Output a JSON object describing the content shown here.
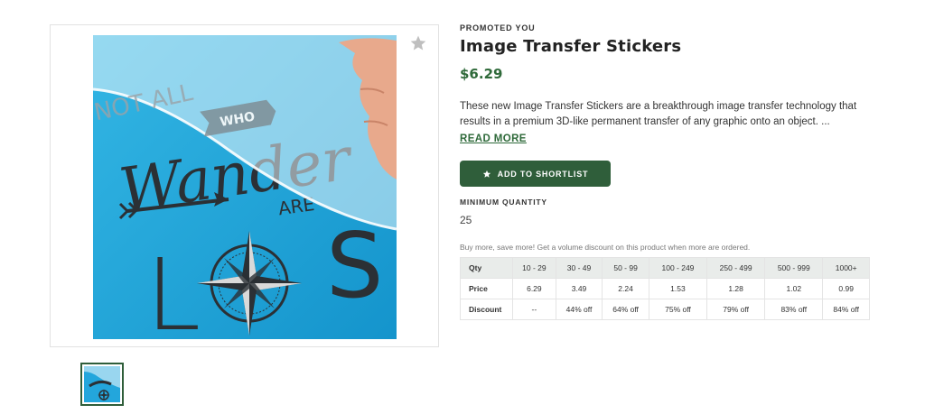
{
  "product": {
    "eyebrow": "PROMOTED YOU",
    "title": "Image Transfer Stickers",
    "price": "$6.29",
    "description": "These new Image Transfer Stickers are a breakthrough image transfer technology that results in a premium 3D-like permanent transfer of any graphic onto an object. ...",
    "read_more": "READ MORE",
    "shortlist_label": "ADD TO SHORTLIST",
    "min_qty_label": "MINIMUM QUANTITY",
    "min_qty_value": "25",
    "volume_note": "Buy more, save more! Get a volume discount on this product when more are ordered.",
    "image_text": {
      "top": "NOT ALL",
      "who": "WHO",
      "script": "Wander",
      "are": "ARE",
      "l": "L",
      "s": "S"
    }
  },
  "pricing_table": {
    "headers": [
      "Qty",
      "10 - 29",
      "30 - 49",
      "50 - 99",
      "100 - 249",
      "250 - 499",
      "500 - 999",
      "1000+"
    ],
    "price_row": [
      "Price",
      "6.29",
      "3.49",
      "2.24",
      "1.53",
      "1.28",
      "1.02",
      "0.99"
    ],
    "discount_row": [
      "Discount",
      "--",
      "44% off",
      "64% off",
      "75% off",
      "79% off",
      "83% off",
      "84% off"
    ]
  },
  "colors": {
    "brand_green": "#2f5e3a",
    "price_green": "#2f6a3a",
    "image_blue": "#1a9fd4"
  },
  "icons": {
    "favorite": "star-icon",
    "button": "star-icon"
  }
}
